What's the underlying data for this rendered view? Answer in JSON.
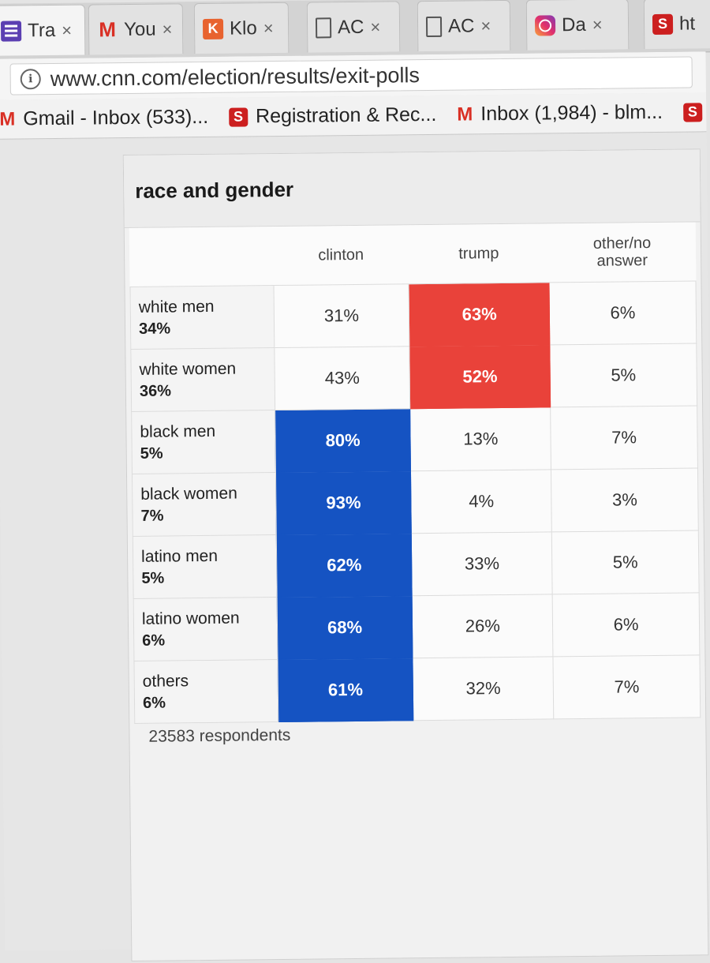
{
  "browser": {
    "tabs": [
      {
        "label": "Tra",
        "icon": "list-icon"
      },
      {
        "label": "You",
        "icon": "gmail-icon"
      },
      {
        "label": "Klo",
        "icon": "k-icon"
      },
      {
        "label": "AC",
        "icon": "document-icon"
      },
      {
        "label": "AC",
        "icon": "document-icon"
      },
      {
        "label": "Da",
        "icon": "instagram-icon"
      },
      {
        "label": "ht",
        "icon": "ncstate-icon"
      }
    ],
    "close_glyph": "×",
    "url": "www.cnn.com/election/results/exit-polls",
    "bookmarks": [
      {
        "label": "Gmail - Inbox (533)...",
        "icon": "gmail-icon"
      },
      {
        "label": "Registration & Rec...",
        "icon": "ncstate-icon"
      },
      {
        "label": "Inbox (1,984) - blm...",
        "icon": "gmail-icon"
      }
    ]
  },
  "poll": {
    "title": "race and gender",
    "columns": [
      "clinton",
      "trump",
      "other/no answer"
    ],
    "rows": [
      {
        "group": "white men",
        "share": "34%",
        "values": [
          "31%",
          "63%",
          "6%"
        ],
        "winner": 1
      },
      {
        "group": "white women",
        "share": "36%",
        "values": [
          "43%",
          "52%",
          "5%"
        ],
        "winner": 1
      },
      {
        "group": "black men",
        "share": "5%",
        "values": [
          "80%",
          "13%",
          "7%"
        ],
        "winner": 0
      },
      {
        "group": "black women",
        "share": "7%",
        "values": [
          "93%",
          "4%",
          "3%"
        ],
        "winner": 0
      },
      {
        "group": "latino men",
        "share": "5%",
        "values": [
          "62%",
          "33%",
          "5%"
        ],
        "winner": 0
      },
      {
        "group": "latino women",
        "share": "6%",
        "values": [
          "68%",
          "26%",
          "6%"
        ],
        "winner": 0
      },
      {
        "group": "others",
        "share": "6%",
        "values": [
          "61%",
          "32%",
          "7%"
        ],
        "winner": 0
      }
    ],
    "respondents": "23583 respondents",
    "colors": {
      "clinton": "#1553c2",
      "trump": "#e9423a"
    }
  }
}
